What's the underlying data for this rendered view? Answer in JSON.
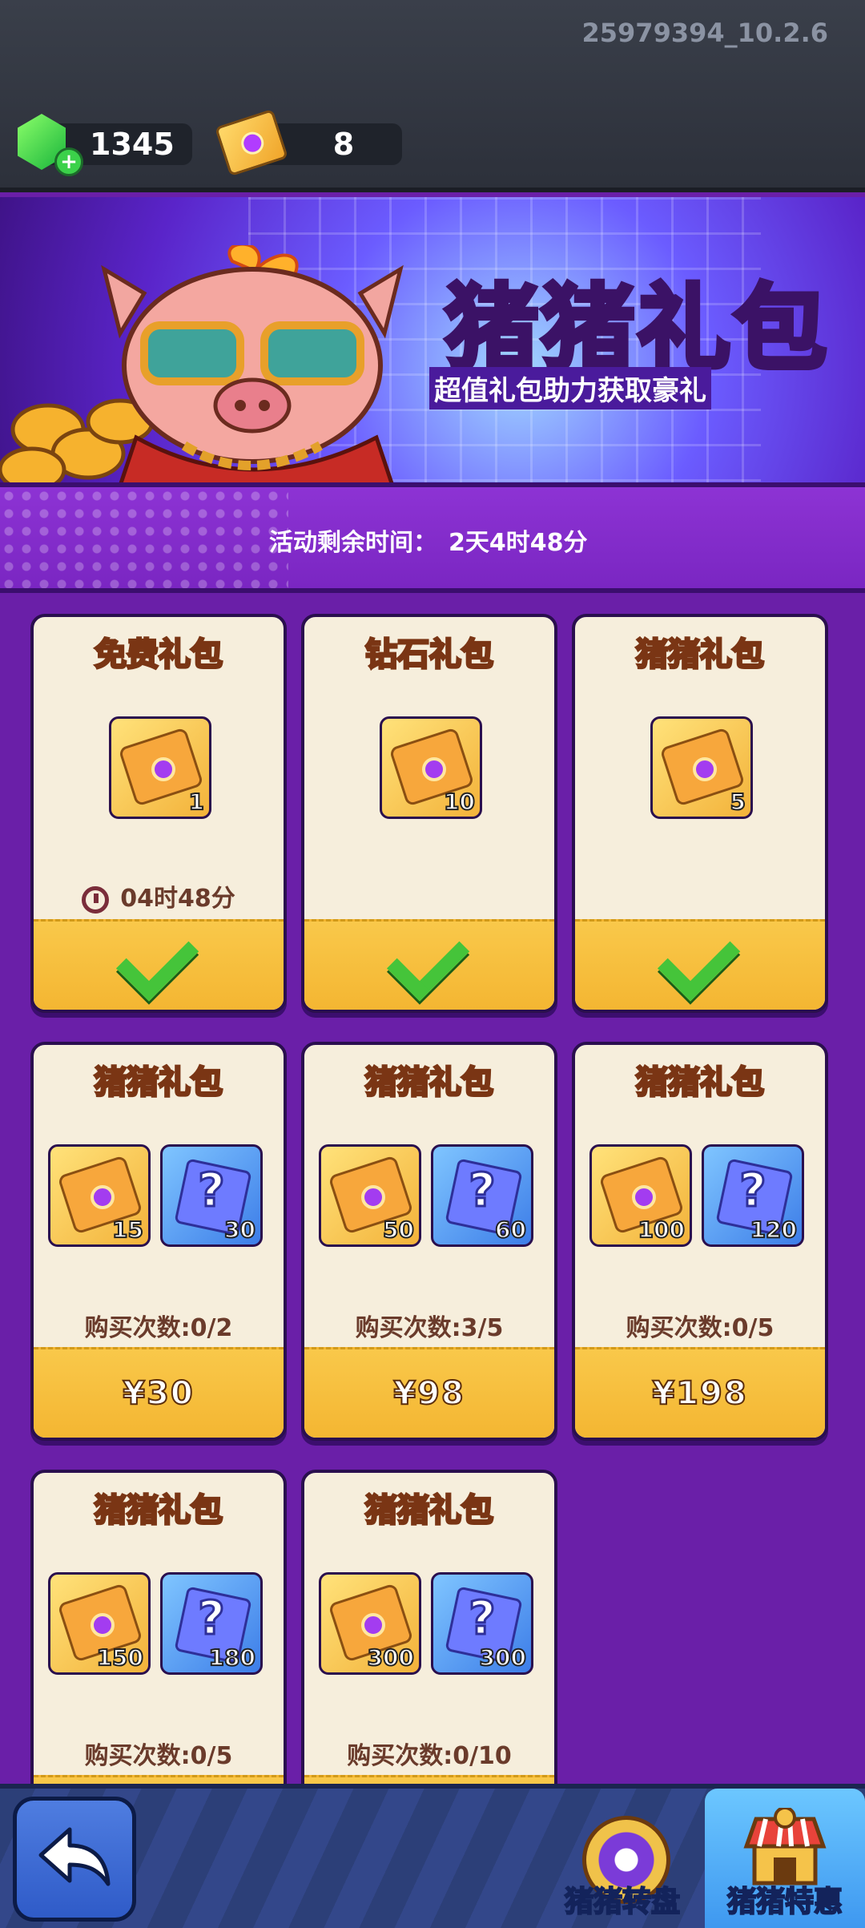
{
  "header": {
    "version": "25979394_10.2.6",
    "gems": "1345",
    "tickets": "8"
  },
  "banner": {
    "title": "猪猪礼包",
    "subtitle": "超值礼包助力获取豪礼"
  },
  "event": {
    "remaining_label": "活动剩余时间：",
    "remaining_value": "2天4时48分"
  },
  "cards": [
    {
      "title": "免费礼包",
      "items": [
        {
          "type": "ticket",
          "qty": "1"
        }
      ],
      "countdown": "04时48分",
      "footer": "check"
    },
    {
      "title": "钻石礼包",
      "items": [
        {
          "type": "ticket",
          "qty": "10"
        }
      ],
      "footer": "check"
    },
    {
      "title": "猪猪礼包",
      "items": [
        {
          "type": "ticket",
          "qty": "5"
        }
      ],
      "footer": "check"
    },
    {
      "title": "猪猪礼包",
      "items": [
        {
          "type": "ticket",
          "qty": "15"
        },
        {
          "type": "mystery",
          "qty": "30"
        }
      ],
      "buy_count": "购买次数:0/2",
      "price": "¥30"
    },
    {
      "title": "猪猪礼包",
      "items": [
        {
          "type": "ticket",
          "qty": "50"
        },
        {
          "type": "mystery",
          "qty": "60"
        }
      ],
      "buy_count": "购买次数:3/5",
      "price": "¥98"
    },
    {
      "title": "猪猪礼包",
      "items": [
        {
          "type": "ticket",
          "qty": "100"
        },
        {
          "type": "mystery",
          "qty": "120"
        }
      ],
      "buy_count": "购买次数:0/5",
      "price": "¥198"
    },
    {
      "title": "猪猪礼包",
      "items": [
        {
          "type": "ticket",
          "qty": "150"
        },
        {
          "type": "mystery",
          "qty": "180"
        }
      ],
      "buy_count": "购买次数:0/5"
    },
    {
      "title": "猪猪礼包",
      "items": [
        {
          "type": "ticket",
          "qty": "300"
        },
        {
          "type": "mystery",
          "qty": "300"
        }
      ],
      "buy_count": "购买次数:0/10"
    }
  ],
  "bottom_nav": {
    "wheel_label": "猪猪转盘",
    "special_label": "猪猪特惠"
  },
  "icons": {
    "gem": "gem-icon",
    "ticket": "ticket-icon",
    "back": "back-arrow-icon",
    "wheel": "wheel-icon",
    "shop": "shop-icon"
  }
}
